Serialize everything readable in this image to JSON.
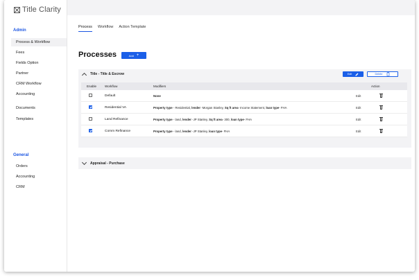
{
  "app": {
    "logo_text": "Title Clarity"
  },
  "sidebar": {
    "admin_title": "Admin",
    "admin_items": [
      {
        "label": "Process & Workflow"
      },
      {
        "label": "Fees"
      },
      {
        "label": "Fields Option"
      },
      {
        "label": "Partner"
      },
      {
        "label": "CRM Workflow"
      },
      {
        "label": "Accounting"
      },
      {
        "label": "Documents"
      },
      {
        "label": "Templates"
      }
    ],
    "general_title": "General",
    "general_items": [
      {
        "label": "Orders"
      },
      {
        "label": "Accounting"
      },
      {
        "label": "CRM"
      }
    ]
  },
  "tabs": [
    {
      "label": "Process",
      "active": true
    },
    {
      "label": "Workflow"
    },
    {
      "label": "Action Template"
    }
  ],
  "page": {
    "title": "Processes",
    "add_label": "Add",
    "add_icon": "+"
  },
  "panel1": {
    "title": "Title - Title & Escrow",
    "expanded": true,
    "edit_label": "Edit",
    "delete_label": "Delete",
    "columns": {
      "enable": "Enable",
      "workflow": "Workflow",
      "modifiers": "Modifiers",
      "action": "Action"
    },
    "rows": [
      {
        "enabled": false,
        "workflow": "Default",
        "modifiers": "None",
        "edit": "Edit"
      },
      {
        "enabled": true,
        "workflow": "Residential VA",
        "edit": "Edit",
        "modifier_parts": [
          [
            "Property type",
            " - Residential, "
          ],
          [
            "lender",
            " -Morgan Stanley, "
          ],
          [
            "Sq ft area",
            "- Income Statement, "
          ],
          [
            "loan type",
            "- FHA"
          ]
        ]
      },
      {
        "enabled": false,
        "workflow": "Land Refinance",
        "edit": "Edit",
        "modifier_parts": [
          [
            "Property type",
            " - land, "
          ],
          [
            "lender",
            " -JP Stanley, "
          ],
          [
            "Sq ft area",
            "- 300, "
          ],
          [
            "loan type",
            "- FHA"
          ]
        ]
      },
      {
        "enabled": true,
        "workflow": "Comm Refinance",
        "edit": "Edit",
        "modifier_parts": [
          [
            "Property type",
            " - land, "
          ],
          [
            "lender",
            " -JP Stanley, "
          ],
          [
            "loan type",
            "- FHA"
          ]
        ]
      }
    ]
  },
  "panel2": {
    "title": "Appraisal - Purchase",
    "expanded": false
  },
  "colors": {
    "accent": "#1b5fe8",
    "sidebar_section": "#1b55e2",
    "panel_bg": "#f3f3f5"
  }
}
